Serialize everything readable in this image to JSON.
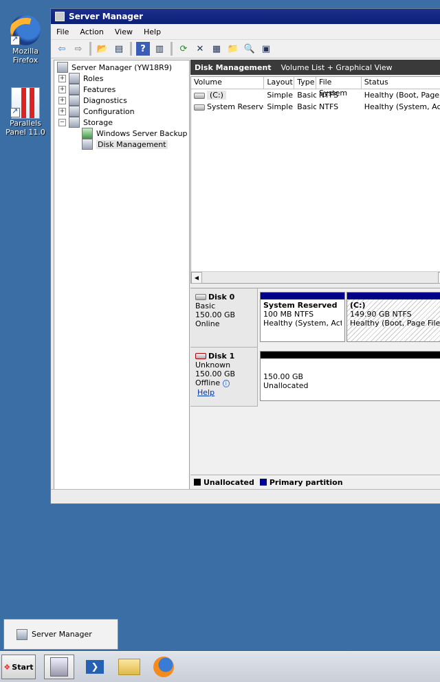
{
  "desktop": {
    "icons": [
      {
        "label": "Mozilla Firefox"
      },
      {
        "label": "Parallels Panel 11.0"
      }
    ]
  },
  "window": {
    "title": "Server Manager",
    "menu": [
      "File",
      "Action",
      "View",
      "Help"
    ],
    "tree": {
      "root": "Server Manager (YW18R9)",
      "items": [
        "Roles",
        "Features",
        "Diagnostics",
        "Configuration",
        "Storage"
      ],
      "storage_children": [
        "Windows Server Backup",
        "Disk Management"
      ]
    },
    "panel": {
      "title": "Disk Management",
      "subtitle": "Volume List + Graphical View",
      "columns": [
        "Volume",
        "Layout",
        "Type",
        "File System",
        "Status"
      ],
      "volumes": [
        {
          "volume": "(C:)",
          "layout": "Simple",
          "type": "Basic",
          "fs": "NTFS",
          "status": "Healthy (Boot, Page F"
        },
        {
          "volume": "System Reserved",
          "layout": "Simple",
          "type": "Basic",
          "fs": "NTFS",
          "status": "Healthy (System, Act"
        }
      ]
    },
    "disks": [
      {
        "name": "Disk 0",
        "kind": "Basic",
        "size": "150.00 GB",
        "state": "Online",
        "partitions": [
          {
            "name": "System Reserved",
            "size": "100 MB NTFS",
            "status": "Healthy (System, Activ"
          },
          {
            "name": "(C:)",
            "size": "149.90 GB NTFS",
            "status": "Healthy (Boot, Page File, C"
          }
        ]
      },
      {
        "name": "Disk 1",
        "kind": "Unknown",
        "size": "150.00 GB",
        "state": "Offline",
        "help": "Help",
        "partitions": [
          {
            "size": "150.00 GB",
            "status": "Unallocated"
          }
        ]
      }
    ],
    "legend": [
      "Unallocated",
      "Primary partition"
    ],
    "colors": {
      "unallocated": "#000000",
      "primary": "#00008b"
    }
  },
  "taskbar": {
    "start_label": "Start",
    "preview_label": "Server Manager"
  }
}
